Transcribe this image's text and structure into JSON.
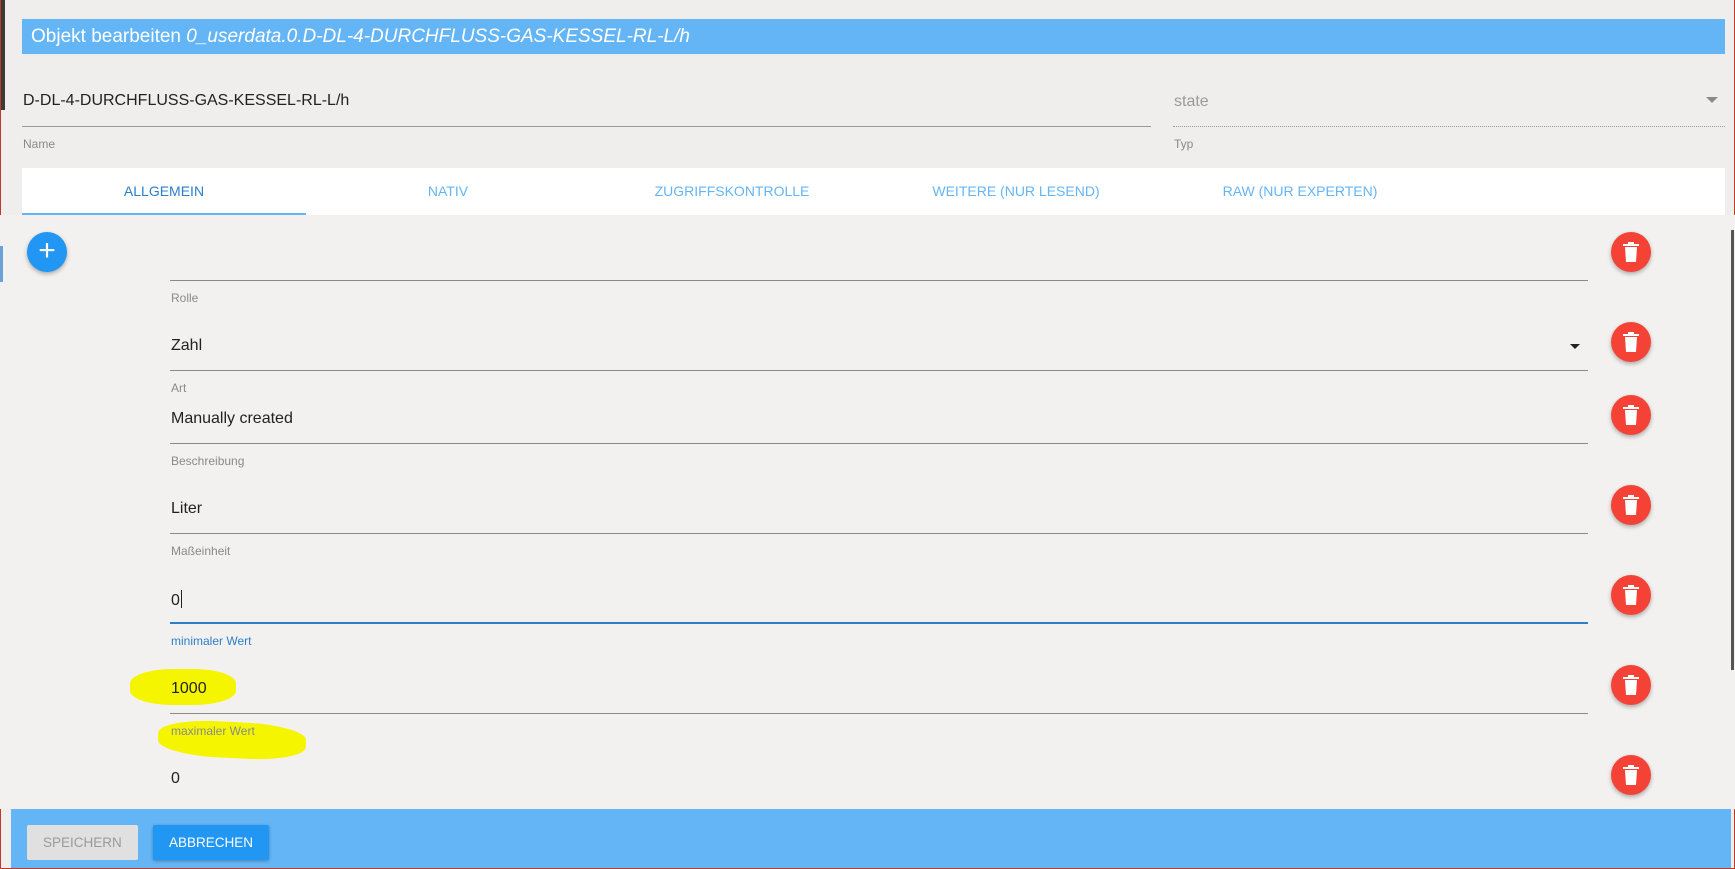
{
  "dialog": {
    "title_prefix": "Objekt bearbeiten",
    "object_id": "0_userdata.0.D-DL-4-DURCHFLUSS-GAS-KESSEL-RL-L/h"
  },
  "name_field": {
    "value": "D-DL-4-DURCHFLUSS-GAS-KESSEL-RL-L/h",
    "label": "Name"
  },
  "type_field": {
    "value": "state",
    "label": "Typ"
  },
  "tabs": [
    {
      "label": "ALLGEMEIN",
      "active": true
    },
    {
      "label": "NATIV",
      "active": false
    },
    {
      "label": "ZUGRIFFSKONTROLLE",
      "active": false
    },
    {
      "label": "WEITERE (NUR LESEND)",
      "active": false
    },
    {
      "label": "RAW (NUR EXPERTEN)",
      "active": false
    }
  ],
  "add_button": {
    "symbol": "+",
    "icon": "plus-icon"
  },
  "fields": [
    {
      "key": "role",
      "label": "Rolle",
      "value": ""
    },
    {
      "key": "type",
      "label": "Art",
      "value": "Zahl"
    },
    {
      "key": "desc",
      "label": "Beschreibung",
      "value": "Manually created"
    },
    {
      "key": "unit",
      "label": "Maßeinheit",
      "value": "Liter"
    },
    {
      "key": "min",
      "label": "minimaler Wert",
      "value": "0",
      "focused": true
    },
    {
      "key": "max",
      "label": "maximaler Wert",
      "value": "1000",
      "highlighted": true
    },
    {
      "key": "default",
      "label": "",
      "value": "0"
    }
  ],
  "delete_icon": "trash-icon",
  "footer": {
    "save_label": "SPEICHERN",
    "cancel_label": "ABBRECHEN"
  },
  "colors": {
    "title_bar": "#64b5f6",
    "accent": "#2196f3",
    "delete": "#f44336",
    "highlight": "#f5f500"
  }
}
